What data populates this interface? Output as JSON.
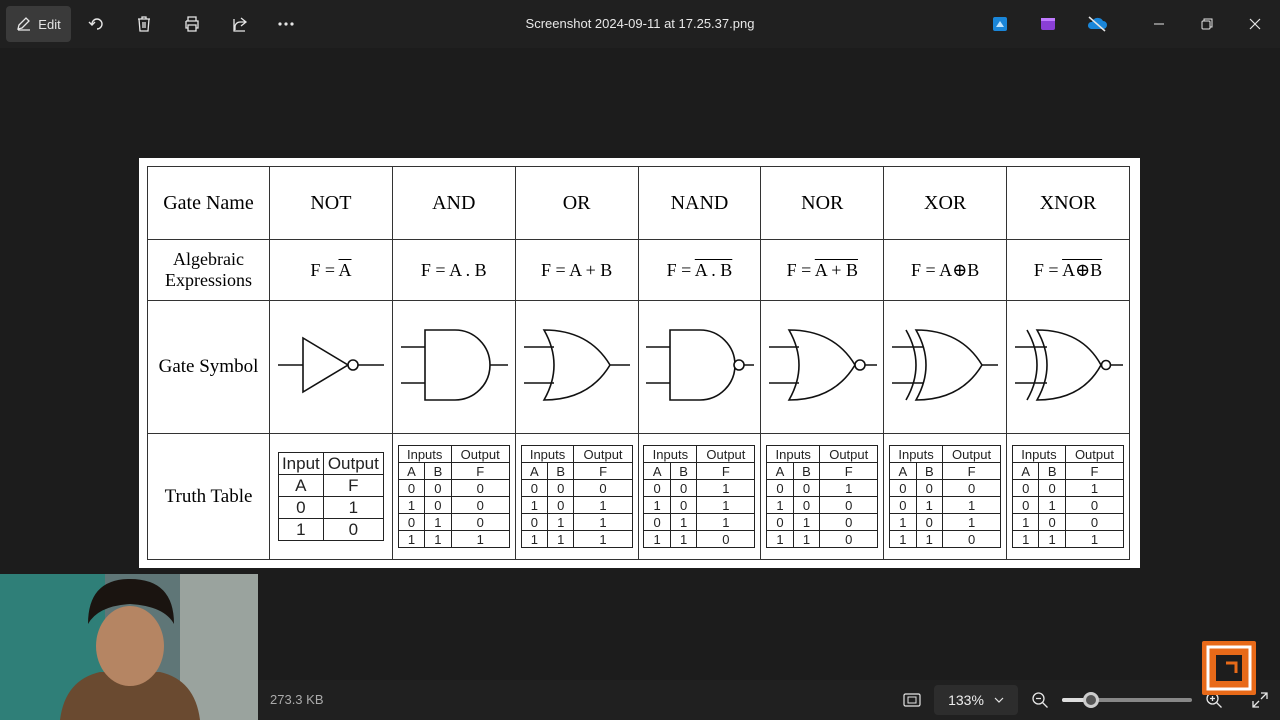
{
  "toolbar": {
    "edit_label": "Edit",
    "icons": [
      "rotate-icon",
      "delete-icon",
      "print-icon",
      "share-icon",
      "more-icon"
    ]
  },
  "window": {
    "title": "Screenshot 2024-09-11 at 17.25.37.png"
  },
  "gate_table": {
    "row_labels": [
      "Gate Name",
      "Algebraic Expressions",
      "Gate Symbol",
      "Truth Table"
    ],
    "gates": [
      "NOT",
      "AND",
      "OR",
      "NAND",
      "NOR",
      "XOR",
      "XNOR"
    ],
    "expressions": [
      {
        "pre": "F = ",
        "over": "A",
        "post": ""
      },
      {
        "pre": "F = A . B",
        "over": "",
        "post": ""
      },
      {
        "pre": "F = A + B",
        "over": "",
        "post": ""
      },
      {
        "pre": "F = ",
        "over": "A . B",
        "post": ""
      },
      {
        "pre": "F = ",
        "over": "A + B",
        "post": ""
      },
      {
        "pre": "F = A⊕B",
        "over": "",
        "post": ""
      },
      {
        "pre": "F = ",
        "over": "A⊕B",
        "post": ""
      }
    ],
    "not_truth": {
      "headers": [
        "Input",
        "Output"
      ],
      "sub": [
        "A",
        "F"
      ],
      "rows": [
        [
          "0",
          "1"
        ],
        [
          "1",
          "0"
        ]
      ]
    },
    "two_input_headers": [
      "Inputs",
      "Output"
    ],
    "two_input_sub": [
      "A",
      "B",
      "F"
    ],
    "truth_tables": [
      [
        [
          "0",
          "0",
          "0"
        ],
        [
          "1",
          "0",
          "0"
        ],
        [
          "0",
          "1",
          "0"
        ],
        [
          "1",
          "1",
          "1"
        ]
      ],
      [
        [
          "0",
          "0",
          "0"
        ],
        [
          "1",
          "0",
          "1"
        ],
        [
          "0",
          "1",
          "1"
        ],
        [
          "1",
          "1",
          "1"
        ]
      ],
      [
        [
          "0",
          "0",
          "1"
        ],
        [
          "1",
          "0",
          "1"
        ],
        [
          "0",
          "1",
          "1"
        ],
        [
          "1",
          "1",
          "0"
        ]
      ],
      [
        [
          "0",
          "0",
          "1"
        ],
        [
          "1",
          "0",
          "0"
        ],
        [
          "0",
          "1",
          "0"
        ],
        [
          "1",
          "1",
          "0"
        ]
      ],
      [
        [
          "0",
          "0",
          "0"
        ],
        [
          "0",
          "1",
          "1"
        ],
        [
          "1",
          "0",
          "1"
        ],
        [
          "1",
          "1",
          "0"
        ]
      ],
      [
        [
          "0",
          "0",
          "1"
        ],
        [
          "0",
          "1",
          "0"
        ],
        [
          "1",
          "0",
          "0"
        ],
        [
          "1",
          "1",
          "1"
        ]
      ]
    ]
  },
  "status": {
    "file_size": "273.3 KB",
    "zoom": "133%",
    "zoom_level": 0.22
  }
}
